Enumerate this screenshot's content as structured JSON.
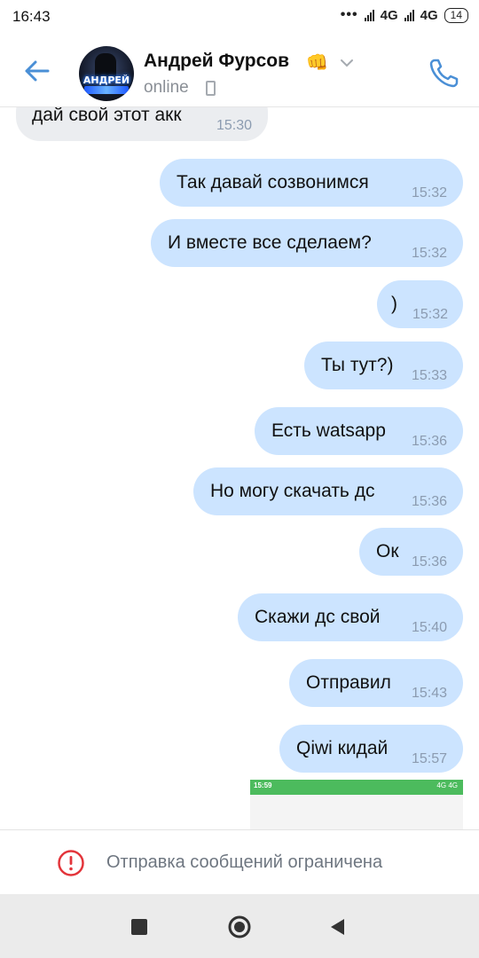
{
  "status_bar": {
    "time": "16:43",
    "dots": "•••",
    "network1": "4G",
    "network2": "4G",
    "battery": "14"
  },
  "header": {
    "contact_name": "Андрей Фурсов",
    "emoji": "👊",
    "status": "online",
    "avatar_text": "АНДРЕЙ"
  },
  "messages": [
    {
      "text": "дай свой этот акк",
      "time": "15:30",
      "direction": "in"
    },
    {
      "text": "Так давай созвонимся",
      "time": "15:32",
      "direction": "out"
    },
    {
      "text": "И вместе все сделаем?",
      "time": "15:32",
      "direction": "out"
    },
    {
      "text": ")",
      "time": "15:32",
      "direction": "out"
    },
    {
      "text": "Ты тут?)",
      "time": "15:33",
      "direction": "out"
    },
    {
      "text": "Есть watsapp",
      "time": "15:36",
      "direction": "out"
    },
    {
      "text": "Но могу скачать дс",
      "time": "15:36",
      "direction": "out"
    },
    {
      "text": "Ок",
      "time": "15:36",
      "direction": "out"
    },
    {
      "text": "Скажи дс свой",
      "time": "15:40",
      "direction": "out"
    },
    {
      "text": "Отправил",
      "time": "15:43",
      "direction": "out"
    },
    {
      "text": "Qiwi кидай",
      "time": "15:57",
      "direction": "out"
    }
  ],
  "screenshot_preview": {
    "time": "15:59",
    "status": "4G 4G"
  },
  "footer": {
    "restricted_text": "Отправка сообщений ограничена"
  },
  "colors": {
    "accent": "#4a8fd6",
    "outgoing_bubble": "#cce4ff",
    "incoming_bubble": "#ebedf0",
    "warning": "#e3353b"
  },
  "icons": {
    "back": "arrow-left-icon",
    "call": "phone-call-icon",
    "warning": "exclamation-circle-icon",
    "chevron": "chevron-down-icon"
  }
}
